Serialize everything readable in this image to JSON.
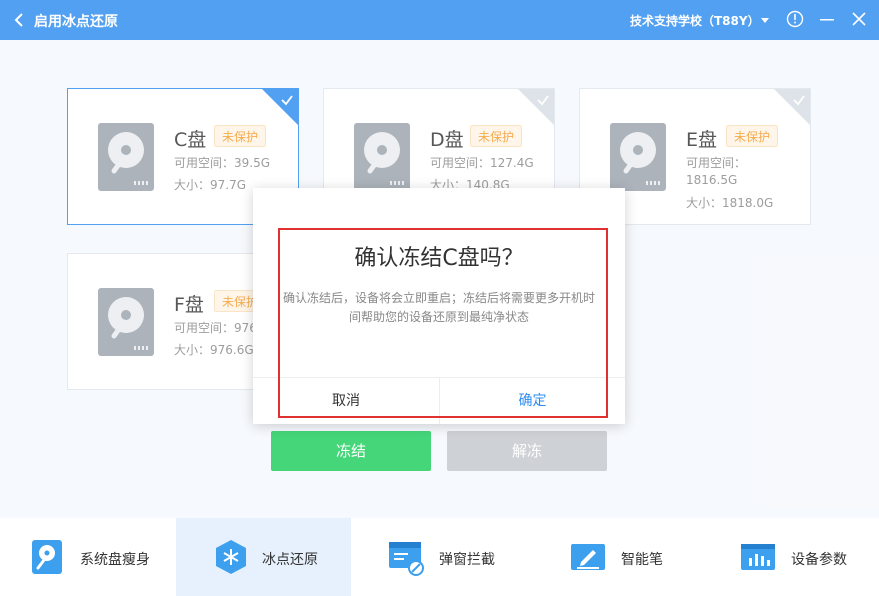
{
  "titlebar": {
    "title": "启用冰点还原",
    "org": "技术支持学校（T88Y）"
  },
  "disks": [
    {
      "name": "C盘",
      "badge": "未保护",
      "free": "可用空间：39.5G",
      "size": "大小：97.7G"
    },
    {
      "name": "D盘",
      "badge": "未保护",
      "free": "可用空间：127.4G",
      "size": "大小：140.8G"
    },
    {
      "name": "E盘",
      "badge": "未保护",
      "free": "可用空间：1816.5G",
      "size": "大小：1818.0G"
    },
    {
      "name": "F盘",
      "badge": "未保护",
      "free": "可用空间：976",
      "size": "大小：976.6G"
    }
  ],
  "actions": {
    "freeze": "冻结",
    "unfreeze": "解冻"
  },
  "dialog": {
    "title": "确认冻结C盘吗？",
    "message": "确认冻结后，设备将会立即重启；冻结后将需要更多开机时间帮助您的设备还原到最纯净状态",
    "cancel": "取消",
    "confirm": "确定"
  },
  "nav": [
    {
      "label": "系统盘瘦身",
      "icon": "disk-slim-icon"
    },
    {
      "label": "冰点还原",
      "icon": "snowflake-shield-icon"
    },
    {
      "label": "弹窗拦截",
      "icon": "popup-block-icon"
    },
    {
      "label": "智能笔",
      "icon": "smart-pen-icon"
    },
    {
      "label": "设备参数",
      "icon": "device-params-icon"
    }
  ],
  "colors": {
    "brand": "#2d8cf0",
    "freeze": "#1dcd5d",
    "badge": "#f39a2b",
    "highlight": "#e03131"
  }
}
